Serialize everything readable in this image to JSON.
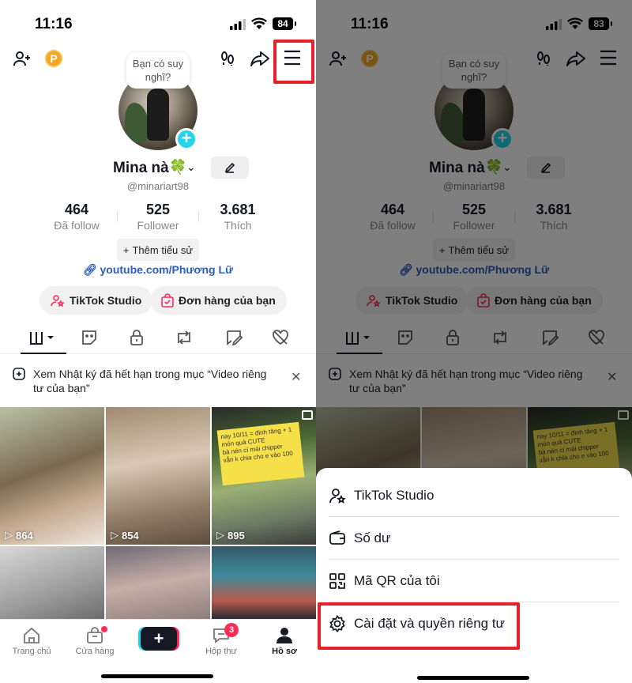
{
  "status_bar": {
    "time": "11:16",
    "battery_left": "84",
    "battery_right": "83"
  },
  "profile": {
    "bubble_text": "Bạn có suy nghĩ?",
    "name": "Mina nà",
    "name_emoji": "🍀",
    "handle": "@minariart98",
    "stats": [
      {
        "value": "464",
        "label": "Đã follow"
      },
      {
        "value": "525",
        "label": "Follower"
      },
      {
        "value": "3.681",
        "label": "Thích"
      }
    ],
    "add_bio_label": "Thêm tiểu sử",
    "link": "youtube.com/Phương Lữ",
    "studio_button": "TikTok Studio",
    "orders_button": "Đơn hàng của bạn"
  },
  "notice": {
    "text": "Xem Nhật ký đã hết hạn trong mục “Video riêng tư của bạn”"
  },
  "videos": [
    {
      "views": "864"
    },
    {
      "views": "854"
    },
    {
      "views": "895"
    }
  ],
  "sticker_text": "nay 10/11 = đinh tăng + 1 món quà CUTE\nbà nén cí mái chipper\nvẫn k chia cho e vào 100",
  "bottom_nav": {
    "items": [
      {
        "label": "Trang chủ"
      },
      {
        "label": "Cửa hàng"
      },
      {
        "label": "Hộp thư",
        "badge": "3"
      },
      {
        "label": "Hồ sơ"
      }
    ]
  },
  "menu_sheet": {
    "items": [
      {
        "label": "TikTok Studio",
        "icon": "person-star-icon"
      },
      {
        "label": "Số dư",
        "icon": "wallet-icon"
      },
      {
        "label": "Mã QR của tôi",
        "icon": "qr-code-icon"
      },
      {
        "label": "Cài đặt và quyền riêng tư",
        "icon": "gear-icon"
      }
    ]
  },
  "colors": {
    "highlight": "#e8202a",
    "tiktok_pink": "#fe2c55",
    "tiktok_cyan": "#20d5ec",
    "link_blue": "#2b5db9"
  }
}
